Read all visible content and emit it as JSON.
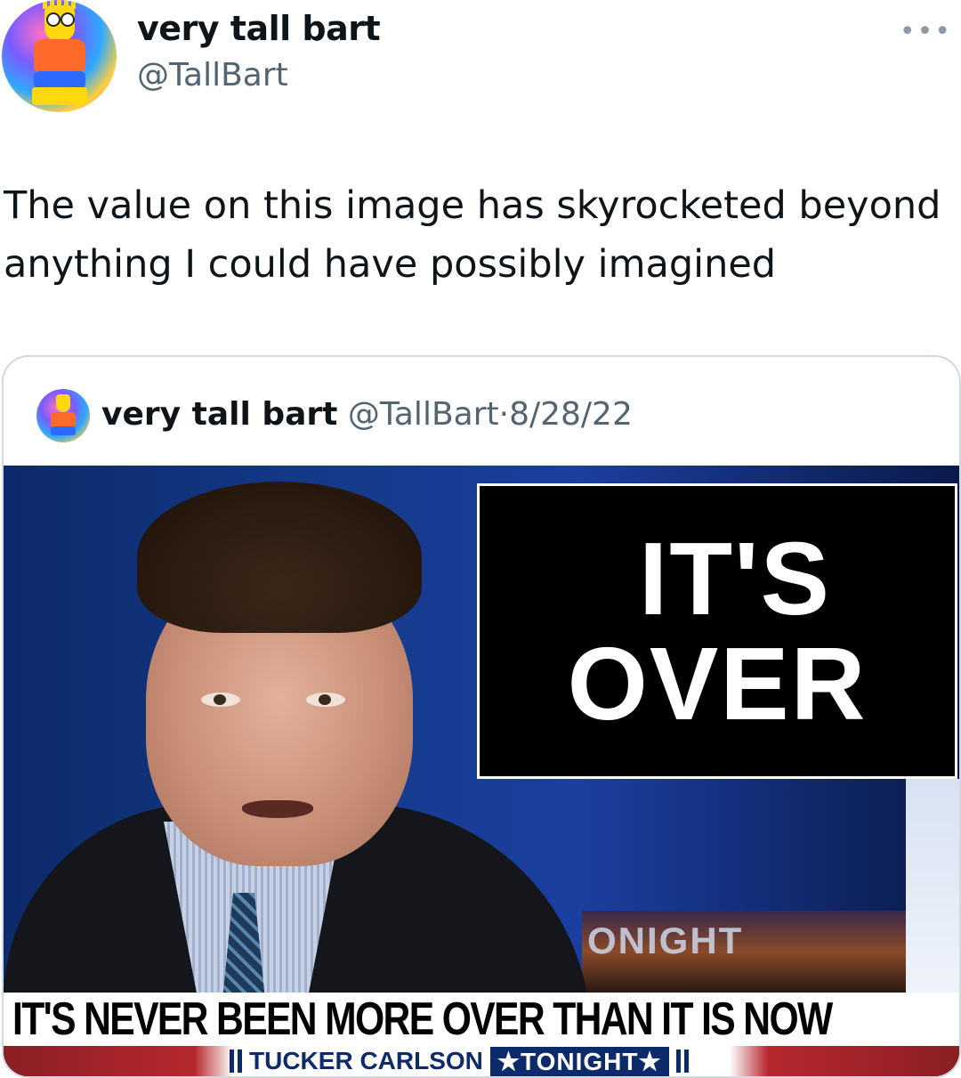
{
  "author": {
    "name": "very tall bart",
    "handle": "@TallBart",
    "avatar_icon": "bart-avatar-icon"
  },
  "more_icon": "•••",
  "tweet": {
    "text": "The value on this image has skyrocketed beyond anything I could have possibly imagined"
  },
  "quoted_tweet": {
    "name": "very tall bart",
    "handle": "@TallBart",
    "separator": "·",
    "date": "8/28/22",
    "image": {
      "box_text_line1": "IT'S",
      "box_text_line2": "OVER",
      "background_text": "ONIGHT",
      "banner": "IT'S NEVER BEEN MORE OVER THAN IT IS NOW",
      "show_name": "TUCKER CARLSON",
      "show_tag": "★TONIGHT★"
    }
  }
}
